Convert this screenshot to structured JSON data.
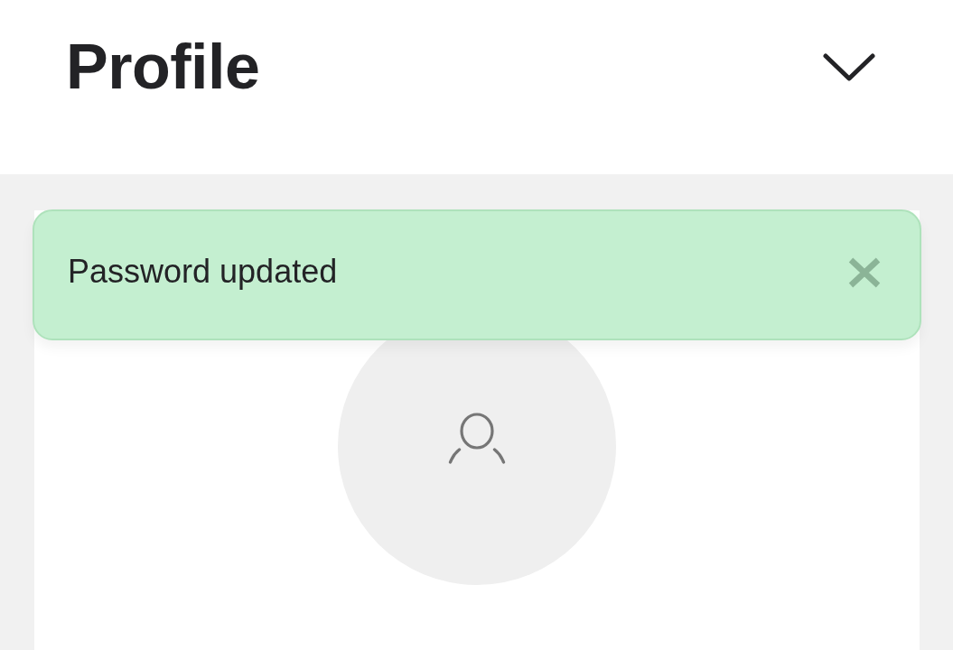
{
  "header": {
    "title": "Profile"
  },
  "toast": {
    "message": "Password updated"
  }
}
